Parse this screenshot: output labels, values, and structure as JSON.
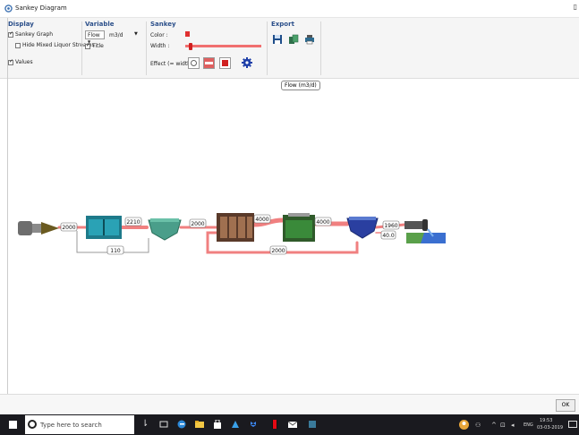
{
  "window": {
    "title": "Sankey Diagram"
  },
  "ribbon": {
    "display": {
      "header": "Display",
      "sankey_graph": "Sankey Graph",
      "hide_mixed": "Hide Mixed Liquor Streams",
      "values": "Values"
    },
    "variable": {
      "header": "Variable",
      "selected": "Flow",
      "unit": "m3/d",
      "title": "Title"
    },
    "sankey": {
      "header": "Sankey",
      "color_label": "Color :",
      "width_label": "Width :",
      "effect_label": "Effect (= width)"
    },
    "export": {
      "header": "Export"
    }
  },
  "colors": {
    "flow": "#f08080",
    "return": "#cc3a3a",
    "ribbon": "#f5f5f5"
  },
  "tooltip": "Flow (m3/d)",
  "flows": {
    "influent": "2000",
    "to_clarifier": "2210",
    "recycle": "110",
    "to_reactor": "2000",
    "to_mbr": "4000",
    "to_settler": "4000",
    "ras": "2000",
    "effluent": "1960",
    "waste": "40.0"
  },
  "bottom": {
    "ok": "OK"
  },
  "taskbar": {
    "search_placeholder": "Type here to search",
    "lang": "ENG",
    "time": "19:53",
    "date": "03-03-2019"
  }
}
